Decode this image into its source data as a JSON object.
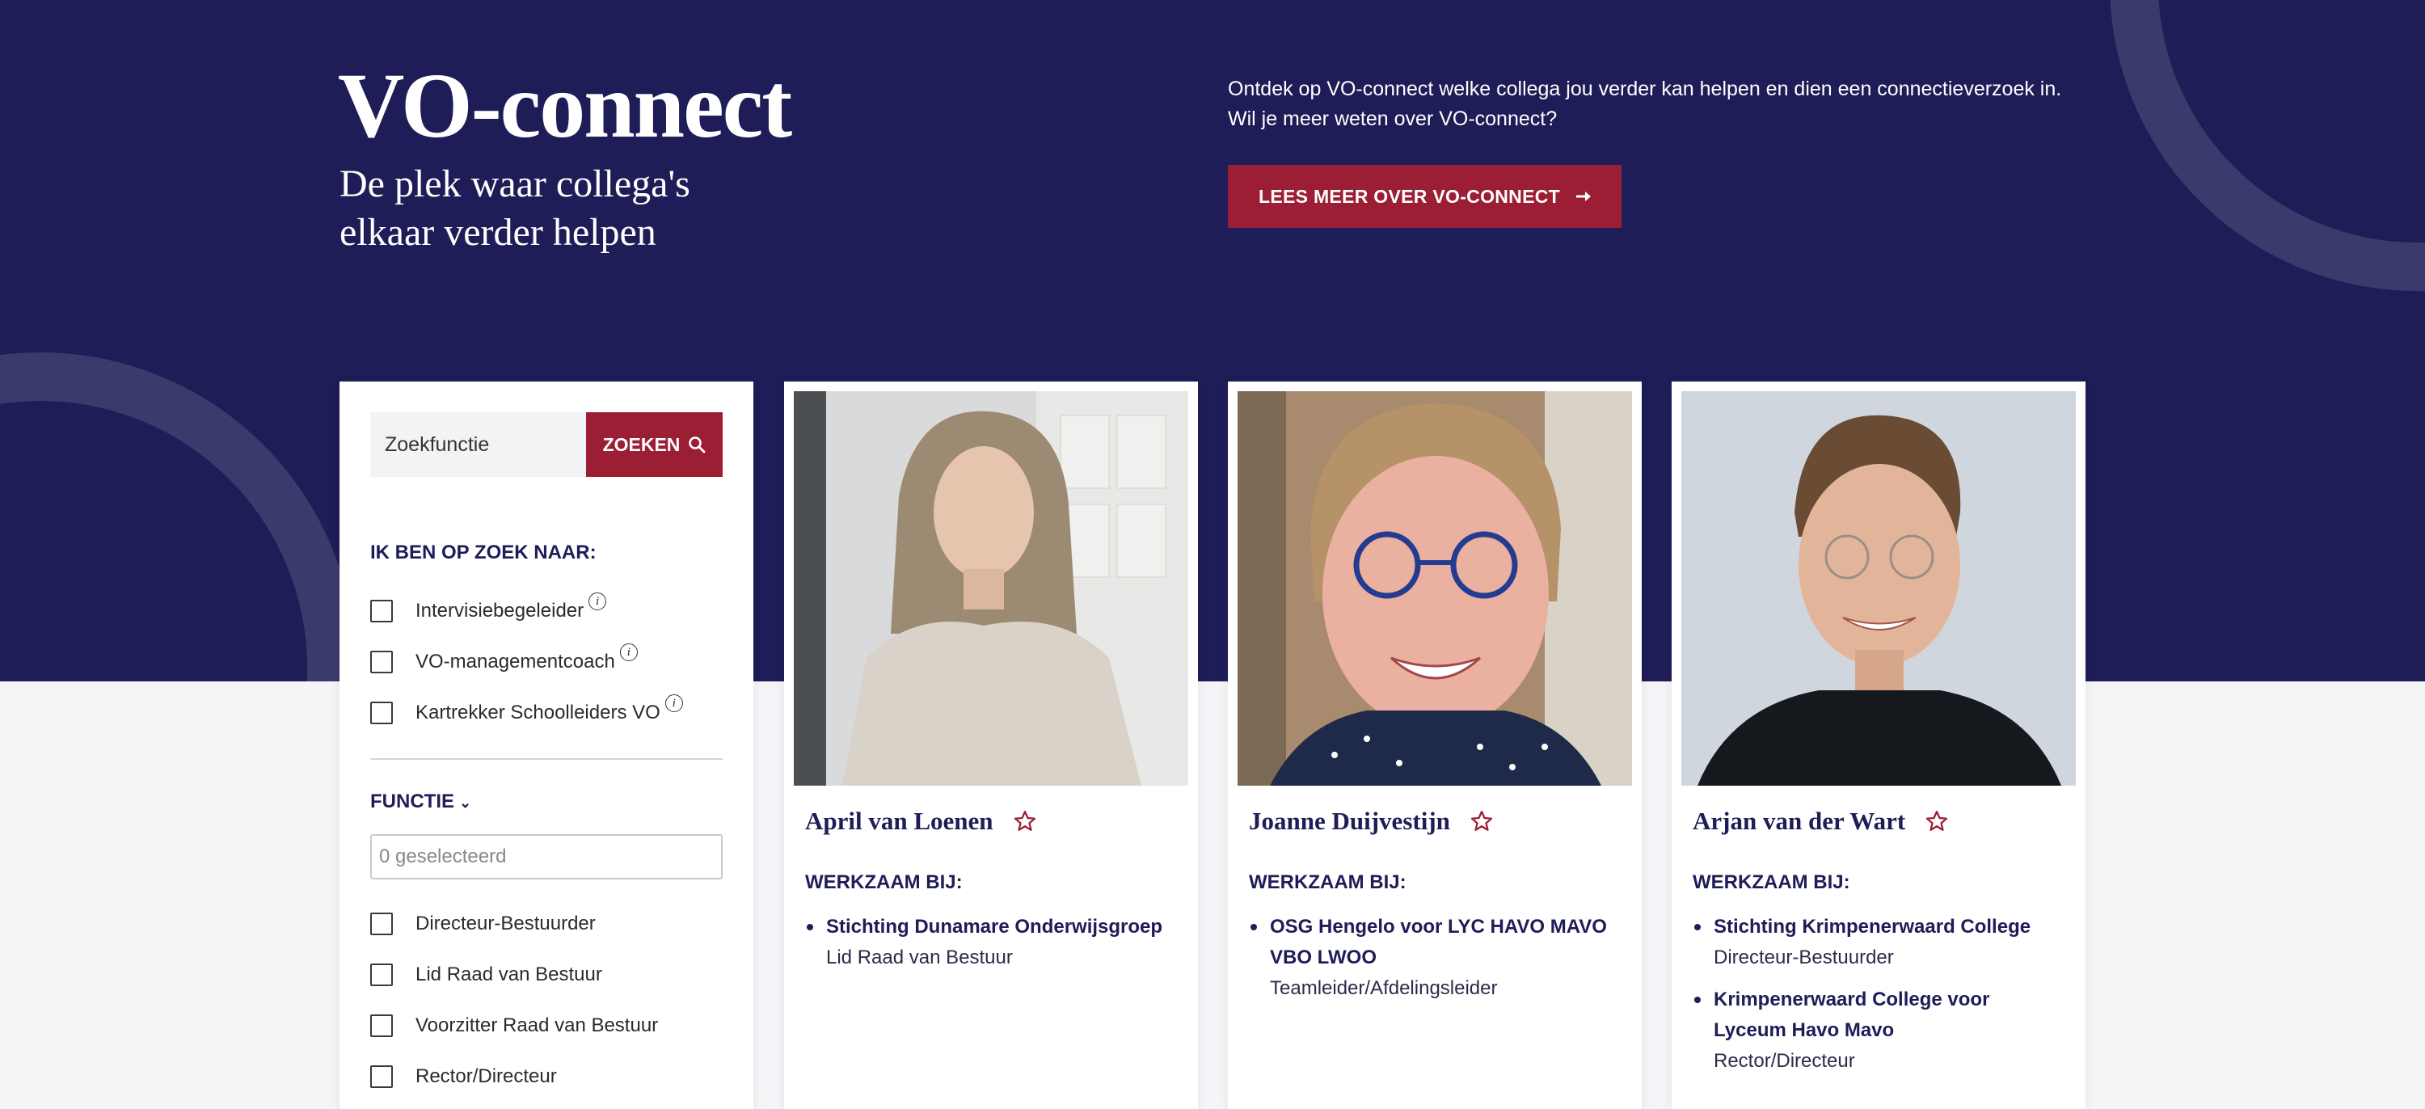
{
  "header": {
    "title": "VO-connect",
    "subtitle": "De plek waar collega's elkaar verder helpen",
    "intro_line1": "Ontdek op VO-connect welke collega jou verder kan helpen en dien een connectieverzoek in.",
    "intro_line2": "Wil je meer weten over VO-connect?",
    "cta_label": "LEES MEER OVER VO-CONNECT",
    "cta_icon": "arrow-right-icon"
  },
  "filters": {
    "search_placeholder": "Zoekfunctie",
    "search_button": "ZOEKEN",
    "looking_for_title": "IK BEN OP ZOEK NAAR:",
    "looking_for_options": [
      {
        "label": "Intervisiebegeleider",
        "checked": false
      },
      {
        "label": "VO-managementcoach",
        "checked": false
      },
      {
        "label": "Kartrekker Schoolleiders VO",
        "checked": false
      }
    ],
    "function_title": "FUNCTIE",
    "function_select_placeholder": "0 geselecteerd",
    "function_options": [
      {
        "label": "Directeur-Bestuurder",
        "checked": false
      },
      {
        "label": "Lid Raad van Bestuur",
        "checked": false
      },
      {
        "label": "Voorzitter Raad van Bestuur",
        "checked": false
      },
      {
        "label": "Rector/Directeur",
        "checked": false
      }
    ]
  },
  "profiles": [
    {
      "name": "April van Loenen",
      "works_at_label": "WERKZAAM BIJ:",
      "orgs": [
        {
          "name": "Stichting Dunamare Onderwijsgroep",
          "role": "Lid Raad van Bestuur"
        }
      ]
    },
    {
      "name": "Joanne Duijvestijn",
      "works_at_label": "WERKZAAM BIJ:",
      "orgs": [
        {
          "name": "OSG Hengelo voor LYC HAVO MAVO VBO LWOO",
          "role": "Teamleider/Afdelingsleider"
        }
      ]
    },
    {
      "name": "Arjan van der Wart",
      "works_at_label": "WERKZAAM BIJ:",
      "orgs": [
        {
          "name": "Stichting Krimpenerwaard College",
          "role": "Directeur-Bestuurder"
        },
        {
          "name": "Krimpenerwaard College voor Lyceum Havo Mavo",
          "role": "Rector/Directeur"
        }
      ]
    }
  ],
  "colors": {
    "navy": "#1e1d57",
    "accent_red": "#9b1e35",
    "background": "#f5f5f8"
  }
}
